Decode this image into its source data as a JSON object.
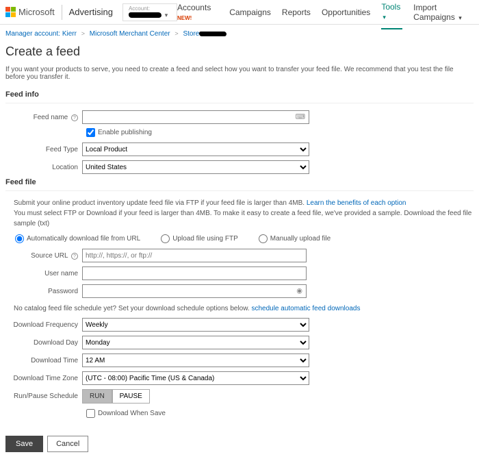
{
  "header": {
    "brand": "Microsoft",
    "product": "Advertising",
    "account_label": "Account:",
    "nav": {
      "accounts": "Accounts",
      "new_badge": "NEW!",
      "campaigns": "Campaigns",
      "reports": "Reports",
      "opportunities": "Opportunities",
      "tools": "Tools",
      "import": "Import Campaigns"
    }
  },
  "breadcrumb": {
    "b1": "Manager account: Kierr",
    "b2": "Microsoft Merchant Center",
    "b3": "Store"
  },
  "page": {
    "title": "Create a feed",
    "intro": "If you want your products to serve, you need to create a feed and select how you want to transfer your feed file. We recommend that you test the file before you transfer it."
  },
  "feed_info": {
    "section": "Feed info",
    "name_label": "Feed name",
    "enable_pub": "Enable publishing",
    "type_label": "Feed Type",
    "type_value": "Local Product",
    "location_label": "Location",
    "location_value": "United States"
  },
  "feed_file": {
    "section": "Feed file",
    "desc1": "Submit your online product inventory update feed file via FTP if your feed file is larger than 4MB. ",
    "learn_link": "Learn the benefits of each option",
    "desc2": "You must select FTP or Download if your feed is larger than 4MB. To make it easy to create a feed file, we've provided a sample. Download the feed file sample (txt)",
    "radio1": "Automatically download file from URL",
    "radio2": "Upload file using FTP",
    "radio3": "Manually upload file",
    "source_url_label": "Source URL",
    "source_url_ph": "http://, https://, or ftp://",
    "username_label": "User name",
    "password_label": "Password"
  },
  "schedule": {
    "desc": "No catalog feed file schedule yet? Set your download schedule options below. ",
    "link": "schedule automatic feed downloads",
    "freq_label": "Download Frequency",
    "freq_value": "Weekly",
    "day_label": "Download Day",
    "day_value": "Monday",
    "time_label": "Download Time",
    "time_value": "12 AM",
    "tz_label": "Download Time Zone",
    "tz_value": "(UTC - 08:00) Pacific Time (US & Canada)",
    "runpause_label": "Run/Pause Schedule",
    "run": "RUN",
    "pause": "PAUSE",
    "dl_when_save": "Download When Save"
  },
  "footer": {
    "save": "Save",
    "cancel": "Cancel"
  }
}
